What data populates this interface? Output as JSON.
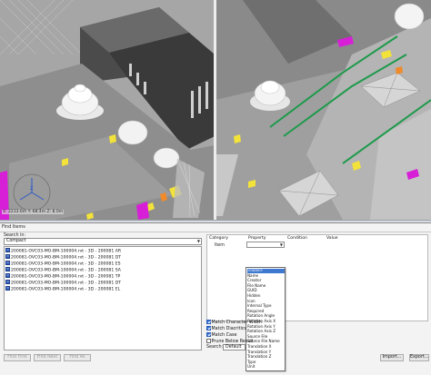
{
  "viewport": {
    "coords_readout": "X: 2233.6m Y: 68.4m Z: 8.0m",
    "compass_label": "Z"
  },
  "colors": {
    "magenta": "#d71fd8",
    "green": "#1e9a4c",
    "yellow": "#f2e23a",
    "orange": "#f08a2a",
    "selection": "#3f78d0"
  },
  "dialog": {
    "title": "Find Items",
    "search_in_label": "Search in:",
    "search_in_value": "Compact",
    "tree_items": [
      "200081-OVC03-MO-BM-100004.rvt - 3D - 200081 AR",
      "200081-OVC03-MO-BM-100004.rvt - 3D - 200081 DT",
      "200081-OVC03-MO-BM-100004.rvt - 3D - 200081 ES",
      "200081-OVC03-MO-BM-100004.rvt - 3D - 200081 SA",
      "200081-OVC03-MO-BM-100004.rvt - 3D - 200081 TP",
      "200081-OVC03-MO-BM-100004.rvt - 3D - 200081 DT",
      "200081-OVC03-MO-BM-100004.rvt - 3D - 200081 EL"
    ],
    "grid_headers": [
      "Category",
      "Property",
      "Condition",
      "Value"
    ],
    "grid_row": {
      "category": "Item",
      "property": ""
    },
    "dropdown_options": [
      "<none>",
      "Name",
      "Creator",
      "File Name",
      "GUID",
      "Hidden",
      "Icon",
      "Internal Type",
      "Required",
      "Rotation Angle",
      "Rotation Axis X",
      "Rotation Axis Y",
      "Rotation Axis Z",
      "Source File",
      "Source File Name",
      "Translation X",
      "Translation Y",
      "Translation Z",
      "Type",
      "Unit"
    ],
    "checkboxes": [
      {
        "label": "Match Character Width",
        "checked": true
      },
      {
        "label": "Match Diacritics",
        "checked": true
      },
      {
        "label": "Match Case",
        "checked": true
      },
      {
        "label": "Prune Below Result",
        "checked": false
      }
    ],
    "search_label": "Search:",
    "search_value": "Default",
    "buttons": {
      "find_first": "Find First",
      "find_next": "Find Next",
      "find_all": "Find All",
      "import": "Import...",
      "export": "Export..."
    }
  }
}
